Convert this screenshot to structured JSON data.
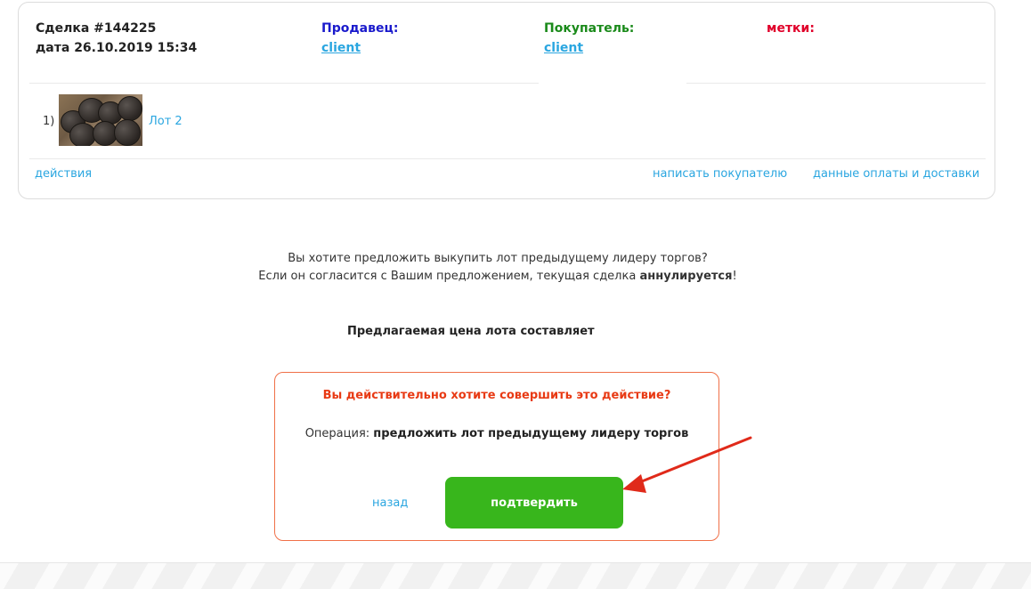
{
  "deal": {
    "id_text": "Сделка #144225",
    "date_text": "дата 26.10.2019 15:34",
    "seller_label": "Продавец:",
    "seller_name": "client",
    "buyer_label": "Покупатель:",
    "buyer_name": "client",
    "tags_label": "метки:",
    "lot_number": "1)",
    "lot_link": "Лот 2",
    "actions_link": "действия",
    "write_buyer_link": "написать покупателю",
    "payment_link": "данные оплаты и доставки"
  },
  "offer": {
    "question": "Вы хотите предложить выкупить лот предыдущему лидеру торгов?",
    "warning_prefix": "Если он согласится с Вашим предложением, текущая сделка ",
    "warning_bold": "аннулируется",
    "warning_suffix": "!",
    "price_text": "Предлагаемая цена лота составляет"
  },
  "confirm": {
    "title": "Вы действительно хотите совершить это действие?",
    "operation_label": "Операция: ",
    "operation_value": "предложить лот предыдущему лидеру торгов",
    "back_label": "назад",
    "confirm_label": "подтвердить"
  },
  "colors": {
    "link": "#2aa6e0",
    "seller": "#1a1acc",
    "buyer": "#1a8a1a",
    "tags": "#e0002a",
    "dialog_border": "#f07048",
    "dialog_title": "#e83a14",
    "confirm_button": "#38b61c",
    "arrow": "#e02a1a"
  },
  "icons": {
    "lot_thumbnail": "coins-photo",
    "annotation": "red-arrow"
  }
}
